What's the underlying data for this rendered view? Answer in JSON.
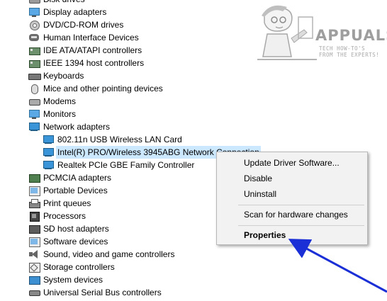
{
  "tree": {
    "items": [
      {
        "label": "Disk drives",
        "icon": "disk-drive-icon",
        "expanded": false
      },
      {
        "label": "Display adapters",
        "icon": "display-adapter-icon",
        "expanded": false
      },
      {
        "label": "DVD/CD-ROM drives",
        "icon": "dvd-drive-icon",
        "expanded": false
      },
      {
        "label": "Human Interface Devices",
        "icon": "hid-icon",
        "expanded": false
      },
      {
        "label": "IDE ATA/ATAPI controllers",
        "icon": "ide-controller-icon",
        "expanded": false
      },
      {
        "label": "IEEE 1394 host controllers",
        "icon": "ieee1394-icon",
        "expanded": false
      },
      {
        "label": "Keyboards",
        "icon": "keyboard-icon",
        "expanded": false
      },
      {
        "label": "Mice and other pointing devices",
        "icon": "mouse-icon",
        "expanded": false
      },
      {
        "label": "Modems",
        "icon": "modem-icon",
        "expanded": false
      },
      {
        "label": "Monitors",
        "icon": "monitor-icon",
        "expanded": false
      },
      {
        "label": "Network adapters",
        "icon": "network-adapter-icon",
        "expanded": true
      },
      {
        "label": "802.11n USB Wireless LAN Card",
        "icon": "network-adapter-icon"
      },
      {
        "label": "Intel(R) PRO/Wireless 3945ABG Network Connection",
        "icon": "network-adapter-icon",
        "selected": true
      },
      {
        "label": "Realtek PCIe GBE Family Controller",
        "icon": "network-adapter-icon"
      },
      {
        "label": "PCMCIA adapters",
        "icon": "pcmcia-icon",
        "expanded": false
      },
      {
        "label": "Portable Devices",
        "icon": "portable-device-icon",
        "expanded": false
      },
      {
        "label": "Print queues",
        "icon": "printer-icon",
        "expanded": false
      },
      {
        "label": "Processors",
        "icon": "processor-icon",
        "expanded": false
      },
      {
        "label": "SD host adapters",
        "icon": "sd-host-icon",
        "expanded": false
      },
      {
        "label": "Software devices",
        "icon": "software-device-icon",
        "expanded": false
      },
      {
        "label": "Sound, video and game controllers",
        "icon": "sound-icon",
        "expanded": false
      },
      {
        "label": "Storage controllers",
        "icon": "storage-controller-icon",
        "expanded": false
      },
      {
        "label": "System devices",
        "icon": "system-device-icon",
        "expanded": false
      },
      {
        "label": "Universal Serial Bus controllers",
        "icon": "usb-icon",
        "expanded": false
      }
    ]
  },
  "context_menu": {
    "items": [
      {
        "label": "Update Driver Software..."
      },
      {
        "label": "Disable"
      },
      {
        "label": "Uninstall"
      },
      {
        "label": "Scan for hardware changes"
      },
      {
        "label": "Properties",
        "bold": true
      }
    ]
  },
  "watermark": {
    "brand": "APPUALS",
    "tagline": "TECH HOW-TO'S FROM THE EXPERTS!"
  },
  "colors": {
    "selection": "#cce8ff",
    "arrow": "#1a2fd6",
    "menu_bg": "#f2f2f2"
  }
}
